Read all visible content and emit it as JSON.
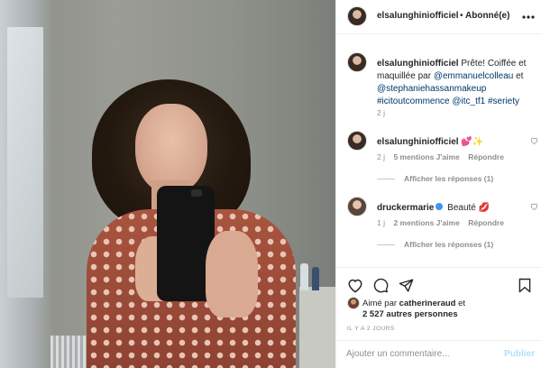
{
  "header": {
    "username": "elsalunghiniofficiel",
    "separator": "•",
    "follow_status": "Abonné(e)",
    "more_icon": "more-horizontal-icon"
  },
  "caption": {
    "username": "elsalunghiniofficiel",
    "text_before": "Prête! Coiffée et maquillée par ",
    "mention1": "@emmanuelcolleau",
    "text_mid": " et ",
    "mention2": "@stephaniehassanmakeup",
    "hashtag1": "#icitoutcommence",
    "mention3": "@itc_tf1",
    "hashtag2": "#seriety",
    "age": "2 j"
  },
  "comments": [
    {
      "username": "elsalunghiniofficiel",
      "emoji": "💕✨",
      "age": "2 j",
      "likes": "5 mentions J'aime",
      "reply": "Répondre",
      "view_replies": "Afficher les réponses (1)"
    },
    {
      "username": "druckermarie",
      "text": "Beauté",
      "emoji": "💋",
      "age": "1 j",
      "likes": "2 mentions J'aime",
      "reply": "Répondre",
      "view_replies": "Afficher les réponses (1)"
    }
  ],
  "actions": {
    "like_icon": "heart-icon",
    "comment_icon": "comment-icon",
    "share_icon": "paper-plane-icon",
    "save_icon": "bookmark-icon"
  },
  "likes": {
    "prefix": "Aimé par ",
    "user": "catherineraud",
    "suffix": " et",
    "count": "2 527 autres personnes"
  },
  "time_ago": "IL Y A 2 JOURS",
  "add_comment": {
    "placeholder": "Ajouter un commentaire...",
    "post_label": "Publier"
  },
  "colors": {
    "link": "#00376b",
    "muted": "#8e8e8e",
    "post_disabled": "#b2dffc",
    "verified": "#3897f0"
  }
}
